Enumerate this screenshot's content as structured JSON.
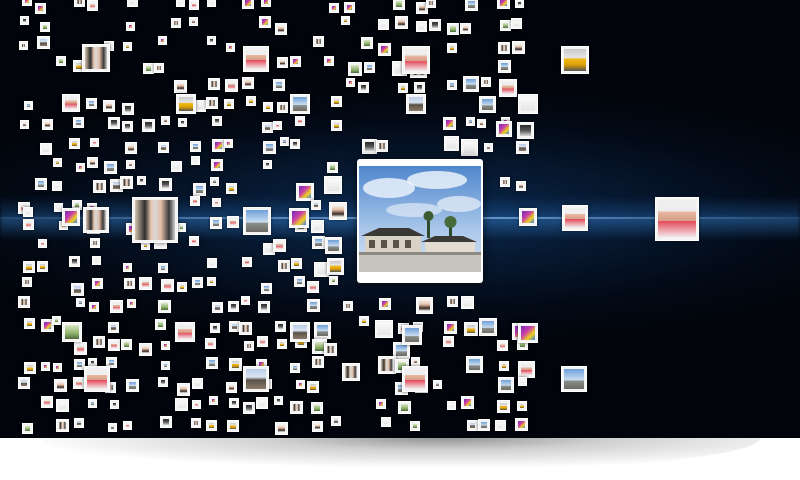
{
  "screen": {
    "background": "#01040a",
    "glow_color": "#0b2a4f"
  },
  "featured_photo": {
    "subject": "traditional-building-under-blue-sky",
    "sky_color": "#6e9fd8",
    "roof_color": "#3b3936"
  },
  "thumbnail_types": [
    "sky",
    "person",
    "pair",
    "car",
    "purple",
    "tower",
    "face",
    "dark",
    "green",
    "white"
  ]
}
